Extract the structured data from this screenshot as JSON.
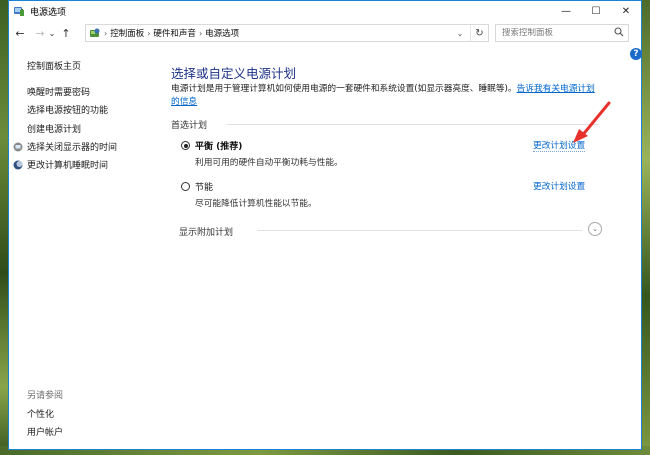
{
  "window": {
    "title": "电源选项",
    "controls": {
      "minimize": "—",
      "maximize": "☐",
      "close": "✕"
    }
  },
  "address": {
    "segments": [
      "控制面板",
      "硬件和声音",
      "电源选项"
    ],
    "separator": "›",
    "dropdown": "⌄",
    "refresh": "↻"
  },
  "nav": {
    "back": "←",
    "forward": "→",
    "recent": "⌄",
    "up": "↑"
  },
  "search": {
    "placeholder": "搜索控制面板",
    "value": ""
  },
  "help": "?",
  "sidebar": {
    "home": "控制面板主页",
    "items": [
      {
        "label": "唤醒时需要密码"
      },
      {
        "label": "选择电源按钮的功能"
      },
      {
        "label": "创建电源计划"
      },
      {
        "label": "选择关闭显示器的时间"
      },
      {
        "label": "更改计算机睡眠时间"
      }
    ],
    "see_also": "另请参阅",
    "links": [
      "个性化",
      "用户帐户"
    ]
  },
  "main": {
    "heading": "选择或自定义电源计划",
    "description": "电源计划是用于管理计算机如何使用电源的一套硬件和系统设置(如显示器亮度、睡眠等)。",
    "description_link": "告诉我有关电源计划的信息",
    "preferred_label": "首选计划",
    "plans": [
      {
        "name": "平衡 (推荐)",
        "description": "利用可用的硬件自动平衡功耗与性能。",
        "link": "更改计划设置",
        "selected": true
      },
      {
        "name": "节能",
        "description": "尽可能降低计算机性能以节能。",
        "link": "更改计划设置",
        "selected": false
      }
    ],
    "extra_plans_label": "显示附加计划",
    "expander": "⌄"
  },
  "colors": {
    "heading": "#1e3287",
    "link": "#0066cc",
    "arrow": "#e8312b",
    "window_border": "#1883d7"
  }
}
